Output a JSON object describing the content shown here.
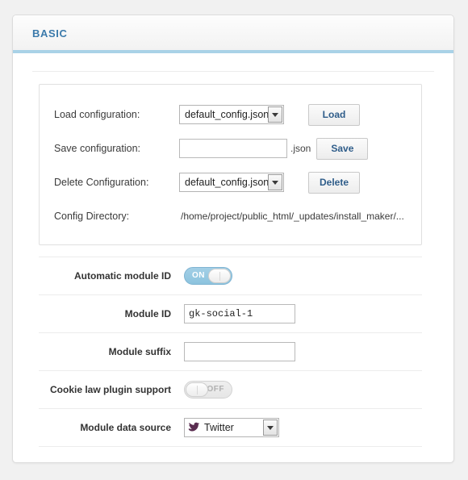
{
  "panel": {
    "title": "BASIC"
  },
  "config": {
    "load": {
      "label": "Load configuration:",
      "selected": "default_config.json",
      "button": "Load"
    },
    "save": {
      "label": "Save configuration:",
      "value": "",
      "placeholder": "",
      "extension": ".json",
      "button": "Save"
    },
    "delete": {
      "label": "Delete Configuration:",
      "selected": "default_config.json",
      "button": "Delete"
    },
    "directory": {
      "label": "Config Directory:",
      "value": "/home/project/public_html/_updates/install_maker/..."
    }
  },
  "settings": {
    "automatic_module_id": {
      "label": "Automatic module ID",
      "state": "ON"
    },
    "module_id": {
      "label": "Module ID",
      "value": "gk-social-1"
    },
    "module_suffix": {
      "label": "Module suffix",
      "value": ""
    },
    "cookie_law": {
      "label": "Cookie law plugin support",
      "state": "OFF"
    },
    "data_source": {
      "label": "Module data source",
      "selected": "Twitter",
      "icon": "twitter-bird-icon"
    }
  },
  "colors": {
    "accent": "#a9d2e7",
    "title": "#3b7aab",
    "button_text": "#2f5d8a",
    "toggle_on": "#8cc3de",
    "bird": "#5a2d50"
  }
}
